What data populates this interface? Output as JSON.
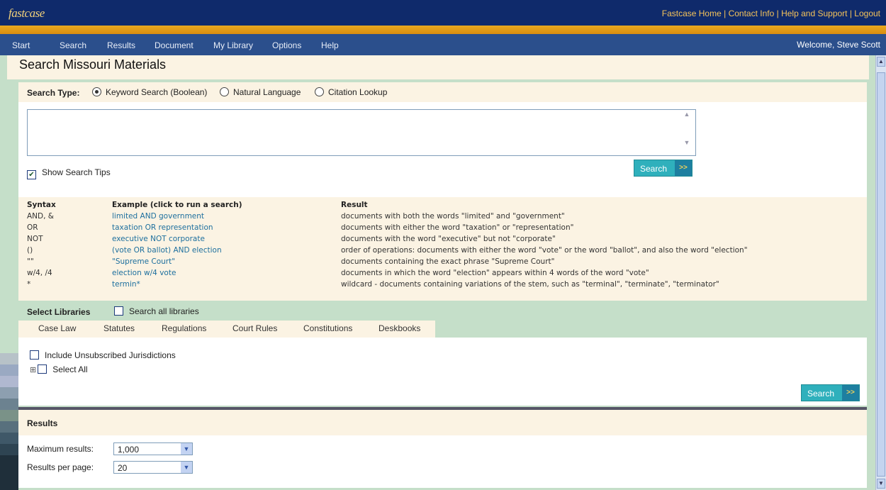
{
  "header": {
    "logo": "fastcase",
    "links": [
      "Fastcase Home",
      "Contact Info",
      "Help and Support",
      "Logout"
    ]
  },
  "nav": {
    "items": [
      "Start",
      "Search",
      "Results",
      "Document",
      "My Library",
      "Options",
      "Help"
    ],
    "welcome": "Welcome, Steve Scott"
  },
  "page": {
    "title": "Search Missouri Materials"
  },
  "search": {
    "type_label": "Search Type:",
    "options": [
      "Keyword Search (Boolean)",
      "Natural Language",
      "Citation Lookup"
    ],
    "selected": "Keyword Search (Boolean)",
    "query": "",
    "show_tips_label": "Show Search Tips",
    "show_tips_checked": true,
    "button_label": "Search",
    "button_arrow": ">>"
  },
  "syntax_table": {
    "headers": [
      "Syntax",
      "Example (click to run a search)",
      "Result"
    ],
    "rows": [
      {
        "syntax": "AND, &",
        "example": "limited AND government",
        "result": "documents with both the words \"limited\" and \"government\""
      },
      {
        "syntax": "OR",
        "example": "taxation OR representation",
        "result": "documents with either the word \"taxation\" or \"representation\""
      },
      {
        "syntax": "NOT",
        "example": "executive NOT corporate",
        "result": "documents with the word \"executive\" but not \"corporate\""
      },
      {
        "syntax": "()",
        "example": "(vote OR ballot) AND election",
        "result": "order of operations: documents with either the word \"vote\" or the word \"ballot\", and also the word \"election\""
      },
      {
        "syntax": "\"\"",
        "example": "\"Supreme Court\"",
        "result": "documents containing the exact phrase \"Supreme Court\""
      },
      {
        "syntax": "w/4, /4",
        "example": "election w/4 vote",
        "result": "documents in which the word \"election\" appears within 4 words of the word \"vote\""
      },
      {
        "syntax": "*",
        "example": "termin*",
        "result": "wildcard - documents containing variations of the stem, such as \"terminal\", \"terminate\", \"terminator\""
      }
    ]
  },
  "libraries": {
    "title": "Select Libraries",
    "search_all_label": "Search all libraries",
    "tabs": [
      "Case Law",
      "Statutes",
      "Regulations",
      "Court Rules",
      "Constitutions",
      "Deskbooks"
    ],
    "include_unsubscribed_label": "Include Unsubscribed Jurisdictions",
    "select_all_label": "Select All",
    "tree_toggle": "⊞",
    "button_label": "Search",
    "button_arrow": ">>"
  },
  "results": {
    "title": "Results",
    "max_label": "Maximum results:",
    "max_value": "1,000",
    "per_page_label": "Results per page:",
    "per_page_value": "20"
  },
  "colors": {
    "header_bg": "#0f2a6b",
    "accent_orange": "#e9a81e",
    "nav_bg": "#2b4f8c",
    "panel_cream": "#fbf3e3",
    "background_green": "#c5dfc9",
    "link_blue": "#1d6f9e",
    "button_teal": "#2fb0bc"
  }
}
